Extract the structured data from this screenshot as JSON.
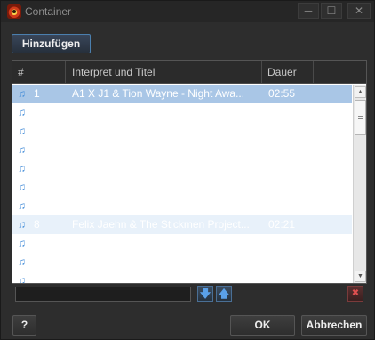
{
  "window": {
    "title": "Container",
    "buttons": {
      "minimize": "─",
      "maximize": "☐",
      "close": "✕"
    }
  },
  "toolbar": {
    "add_label": "Hinzufügen"
  },
  "table": {
    "columns": {
      "num": "#",
      "title": "Interpret und Titel",
      "duration": "Dauer"
    },
    "rows": [
      {
        "num": "1",
        "title": "A1 X J1 & Tion Wayne - Night Awa...",
        "duration": "02:55",
        "state": "selected"
      },
      {
        "num": "",
        "title": "",
        "duration": "",
        "state": "normal"
      },
      {
        "num": "",
        "title": "",
        "duration": "",
        "state": "normal"
      },
      {
        "num": "",
        "title": "",
        "duration": "",
        "state": "normal"
      },
      {
        "num": "",
        "title": "",
        "duration": "",
        "state": "normal"
      },
      {
        "num": "",
        "title": "",
        "duration": "",
        "state": "normal"
      },
      {
        "num": "",
        "title": "",
        "duration": "",
        "state": "normal"
      },
      {
        "num": "8",
        "title": "Felix Jaehn & The Stickmen Project...",
        "duration": "02:21",
        "state": "alt"
      },
      {
        "num": "",
        "title": "",
        "duration": "",
        "state": "normal"
      },
      {
        "num": "",
        "title": "",
        "duration": "",
        "state": "normal"
      },
      {
        "num": "",
        "title": "",
        "duration": "",
        "state": "normal"
      }
    ],
    "row_icon": "music-note-icon",
    "colors": {
      "selected": "#a9c6e6",
      "alt": "#e8f1fa",
      "note": "#4a90d9"
    }
  },
  "list_tools": {
    "filter_value": "",
    "move_down": "🡇",
    "move_up": "🡅",
    "remove": "✖"
  },
  "footer": {
    "help_label": "?",
    "ok_label": "OK",
    "cancel_label": "Abbrechen"
  }
}
